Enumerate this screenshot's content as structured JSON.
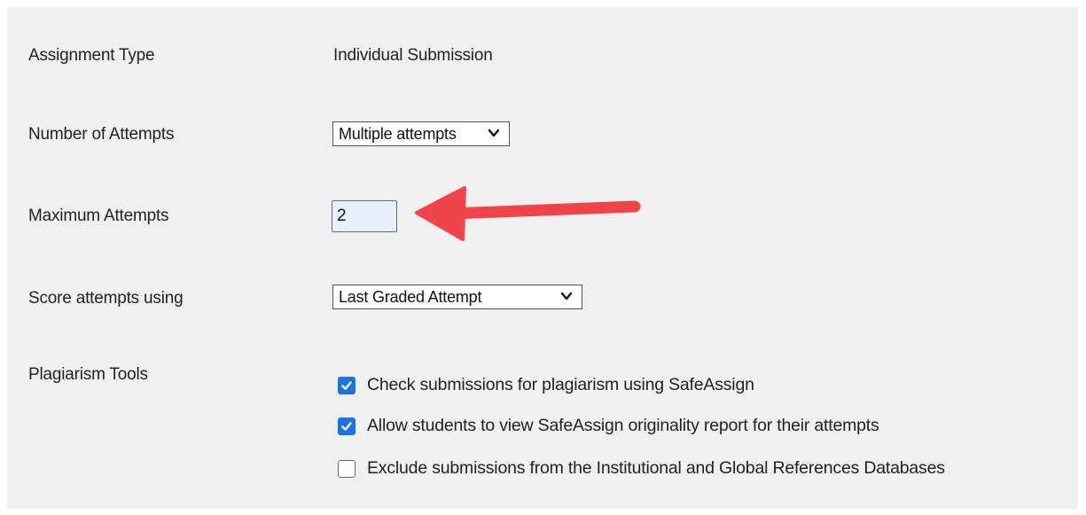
{
  "form": {
    "assignment_type": {
      "label": "Assignment Type",
      "value": "Individual Submission"
    },
    "number_of_attempts": {
      "label": "Number of Attempts",
      "selected": "Multiple attempts"
    },
    "maximum_attempts": {
      "label": "Maximum Attempts",
      "value": "2"
    },
    "score_attempts": {
      "label": "Score attempts using",
      "selected": "Last Graded Attempt"
    },
    "plagiarism": {
      "label": "Plagiarism Tools",
      "options": [
        {
          "label": "Check submissions for plagiarism using SafeAssign",
          "checked": true
        },
        {
          "label": "Allow students to view SafeAssign originality report for their attempts",
          "checked": true
        },
        {
          "label": "Exclude submissions from the Institutional and Global References Databases",
          "checked": false
        }
      ]
    }
  },
  "colors": {
    "panel_bg": "#f0f0f0",
    "checkbox_accent": "#1a73e8",
    "input_bg": "#e8f0fe",
    "annotation_arrow": "#f0444b"
  },
  "icons": {
    "select_chevron": "chevron-down-icon",
    "checkbox_check": "checkmark-icon",
    "annotation": "red-arrow-icon"
  }
}
